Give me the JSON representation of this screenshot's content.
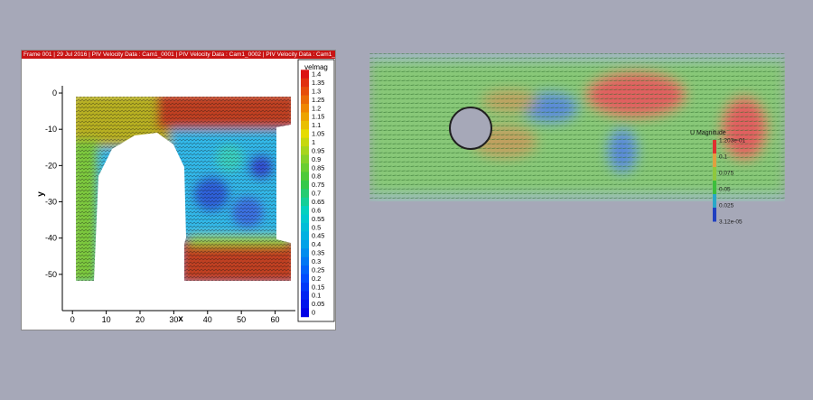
{
  "left_window": {
    "title_bar": "Frame 001 | 29 Jul 2016 | PIV Velocity Data : Cam1_0001 | PIV Velocity Data : Cam1_0002 | PIV Velocity Data : Cam1_",
    "colors": {
      "title_bg": "#c81414",
      "window_bg": "#ffffff"
    }
  },
  "chart_data": [
    {
      "type": "heatmap",
      "title": "",
      "xlabel": "x",
      "ylabel": "y",
      "xlim": [
        -3,
        66
      ],
      "ylim": [
        -60,
        2
      ],
      "x_ticks": [
        0,
        10,
        20,
        30,
        40,
        50,
        60
      ],
      "y_ticks": [
        0,
        -10,
        -20,
        -30,
        -40,
        -50
      ],
      "x_tick_labels": [
        "0",
        "10",
        "20",
        "30",
        "40",
        "50",
        "60"
      ],
      "y_tick_labels": [
        "0",
        "-10",
        "-20",
        "-30",
        "-40",
        "-50"
      ],
      "colorbar": {
        "label": "velmag",
        "min": 0,
        "max": 1.4,
        "tick_labels": [
          "1.4",
          "1.35",
          "1.3",
          "1.25",
          "1.2",
          "1.15",
          "1.1",
          "1.05",
          "1",
          "0.95",
          "0.9",
          "0.85",
          "0.8",
          "0.75",
          "0.7",
          "0.65",
          "0.6",
          "0.55",
          "0.5",
          "0.45",
          "0.4",
          "0.35",
          "0.3",
          "0.25",
          "0.2",
          "0.15",
          "0.1",
          "0.05",
          "0"
        ]
      },
      "legend_position": "right",
      "grid": false
    },
    {
      "type": "heatmap",
      "title": "",
      "colorbar": {
        "label": "U Magnitude",
        "tick_labels": [
          "1.203e-01",
          "0.1",
          "0.075",
          "0.05",
          "0.025",
          "3.12e-05"
        ]
      },
      "legend_position": "inside-right",
      "colors": [
        "#2040c0",
        "#28a8c8",
        "#3cbf3c",
        "#8fc83c",
        "#e0a040",
        "#e03030"
      ]
    }
  ]
}
